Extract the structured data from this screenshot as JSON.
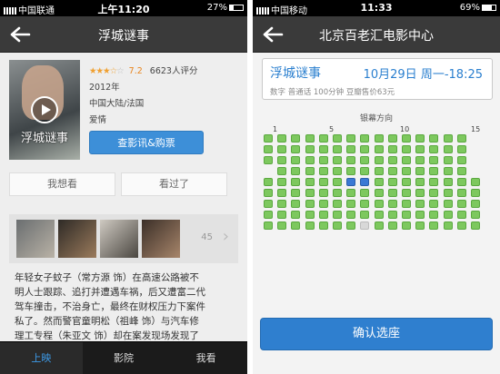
{
  "left": {
    "status": {
      "carrier": "中国联通",
      "time": "上午11:20",
      "battery": "27%",
      "battery_level": 0.27
    },
    "nav": {
      "title": "浮城谜事"
    },
    "movie": {
      "poster_title": "浮城谜事",
      "rating_stars": 3.5,
      "score": "7.2",
      "votes": "6623人评分",
      "year": "2012年",
      "region": "中国大陆/法国",
      "genre": "爱情"
    },
    "buy_button": "查影讯&购票",
    "want_button": "我想看",
    "seen_button": "看过了",
    "stills_count": "45",
    "synopsis_lines": [
      "年轻女子蚊子（常方源 饰）在高速公路被不",
      "明人士跟踪、追打并遭遇车祸，后又遭富二代",
      "驾车撞击，不治身亡，最终在财权压力下案件",
      "私了。然而警官童明松（祖峰 饰）与汽车修",
      "理工专程（朱亚文 饰）却在案发现场发现了"
    ],
    "tabs": [
      {
        "label": "上映",
        "active": true
      },
      {
        "label": "影院",
        "active": false
      },
      {
        "label": "我看",
        "active": false
      }
    ]
  },
  "right": {
    "status": {
      "carrier": "中国移动",
      "time": "11:33",
      "battery": "69%",
      "battery_level": 0.69
    },
    "nav": {
      "title": "北京百老汇电影中心"
    },
    "show": {
      "movie": "浮城谜事",
      "date": "10月29日",
      "weekday": "周一",
      "time": "18:25",
      "meta": "数字 普通话 100分钟 豆瓣售价63元"
    },
    "screen_label": "银幕方向",
    "column_numbers": [
      "1",
      "5",
      "10",
      "15"
    ],
    "confirm_button": "确认选座"
  },
  "colors": {
    "accent": "#2f7fcf",
    "seat_free": "#7dc85e",
    "seat_taken": "#3b79d4",
    "seat_na": "#d8d8d8",
    "star": "#f0a030"
  }
}
